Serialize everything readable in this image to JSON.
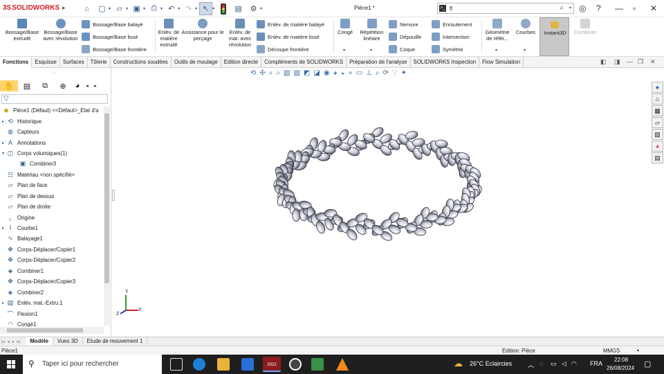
{
  "app": {
    "brand_ds": "3S",
    "brand_name": "SOLIDWORKS",
    "doc_title": "Pièce1 *",
    "search_value": "fl"
  },
  "ribbon": {
    "boss_extrude": "Bossage/Base extrudé",
    "boss_revolve": "Bossage/Base avec révolution",
    "boss_sweep": "Bossage/Base balayé",
    "boss_loft": "Bossage/Base lissé",
    "boss_boundary": "Bossage/Base frontière",
    "cut_extrude": "Enlèv. de matière extrudé",
    "hole_wizard": "Assistance pour le perçage",
    "cut_revolve": "Enlèv. de mat. avec révolution",
    "cut_sweep": "Enlèv. de matière balayé",
    "cut_loft": "Enlèv. de matière lissé",
    "cut_boundary": "Découpe frontière",
    "fillet": "Congé",
    "linear_pattern": "Répétition linéaire",
    "rib": "Nervure",
    "draft": "Dépouille",
    "shell": "Coque",
    "wrap": "Enroulement",
    "intersect": "Intersection",
    "mirror": "Symétrie",
    "ref_geometry": "Géométrie de référ...",
    "curves": "Courbes",
    "instant3d": "Instant3D",
    "combine": "Combiner"
  },
  "tabs": [
    "Fonctions",
    "Esquisse",
    "Surfaces",
    "Tôlerie",
    "Constructions soudées",
    "Outils de moulage",
    "Edition directe",
    "Compléments de SOLIDWORKS",
    "Préparation de l'analyse",
    "SOLIDWORKS Inspection",
    "Flow Simulation"
  ],
  "tree": {
    "root": "Pièce1 (Défaut) <<Défaut>_Etat d'a",
    "items": [
      {
        "label": "Historique",
        "icon": "history-icon",
        "expand": "▸",
        "indent": 0
      },
      {
        "label": "Capteurs",
        "icon": "sensor-icon",
        "expand": "",
        "indent": 0
      },
      {
        "label": "Annotations",
        "icon": "annotation-icon",
        "expand": "▸",
        "indent": 0
      },
      {
        "label": "Corps volumiques(1)",
        "icon": "solid-bodies-icon",
        "expand": "▾",
        "indent": 0
      },
      {
        "label": "Combiner3",
        "icon": "body-icon",
        "expand": "",
        "indent": 1
      },
      {
        "label": "Matériau <non spécifié>",
        "icon": "material-icon",
        "expand": "",
        "indent": 0
      },
      {
        "label": "Plan de face",
        "icon": "plane-icon",
        "expand": "",
        "indent": 0
      },
      {
        "label": "Plan de dessus",
        "icon": "plane-icon",
        "expand": "",
        "indent": 0
      },
      {
        "label": "Plan de droite",
        "icon": "plane-icon",
        "expand": "",
        "indent": 0
      },
      {
        "label": "Origine",
        "icon": "origin-icon",
        "expand": "",
        "indent": 0
      },
      {
        "label": "Courbe1",
        "icon": "curve-icon",
        "expand": "▸",
        "indent": 0
      },
      {
        "label": "Balayage1",
        "icon": "sweep-icon",
        "expand": "",
        "indent": 0
      },
      {
        "label": "Corps-Déplacer/Copier1",
        "icon": "move-copy-icon",
        "expand": "",
        "indent": 0
      },
      {
        "label": "Corps-Déplacer/Copier2",
        "icon": "move-copy-icon",
        "expand": "",
        "indent": 0
      },
      {
        "label": "Combiner1",
        "icon": "combine-icon",
        "expand": "",
        "indent": 0
      },
      {
        "label": "Corps-Déplacer/Copier3",
        "icon": "move-copy-icon",
        "expand": "",
        "indent": 0
      },
      {
        "label": "Combiner2",
        "icon": "combine-icon",
        "expand": "",
        "indent": 0
      },
      {
        "label": "Enlév. mat.-Extru.1",
        "icon": "cut-extrude-icon",
        "expand": "▸",
        "indent": 0
      },
      {
        "label": "Flexion1",
        "icon": "flex-icon",
        "expand": "",
        "indent": 0
      },
      {
        "label": "Congé1",
        "icon": "fillet-icon",
        "expand": "",
        "indent": 0
      }
    ]
  },
  "bottom_tabs": [
    "Modèle",
    "Vues 3D",
    "Etude de mouvement 1"
  ],
  "status": {
    "left": "Pièce1",
    "edit": "Edition: Pièce",
    "units": "MMGS"
  },
  "triad": {
    "x": "X",
    "y": "Y",
    "z": "Z"
  },
  "taskbar": {
    "search_placeholder": "Taper ici pour rechercher",
    "weather": "26°C  Eclaircies",
    "lang": "FRA",
    "time": "22:08",
    "date": "26/08/2024",
    "sw_badge": "2022"
  },
  "colors": {
    "brand_red": "#d32027",
    "accent_blue": "#2f5c8f",
    "taskbar_bg": "#1f1f1f"
  }
}
